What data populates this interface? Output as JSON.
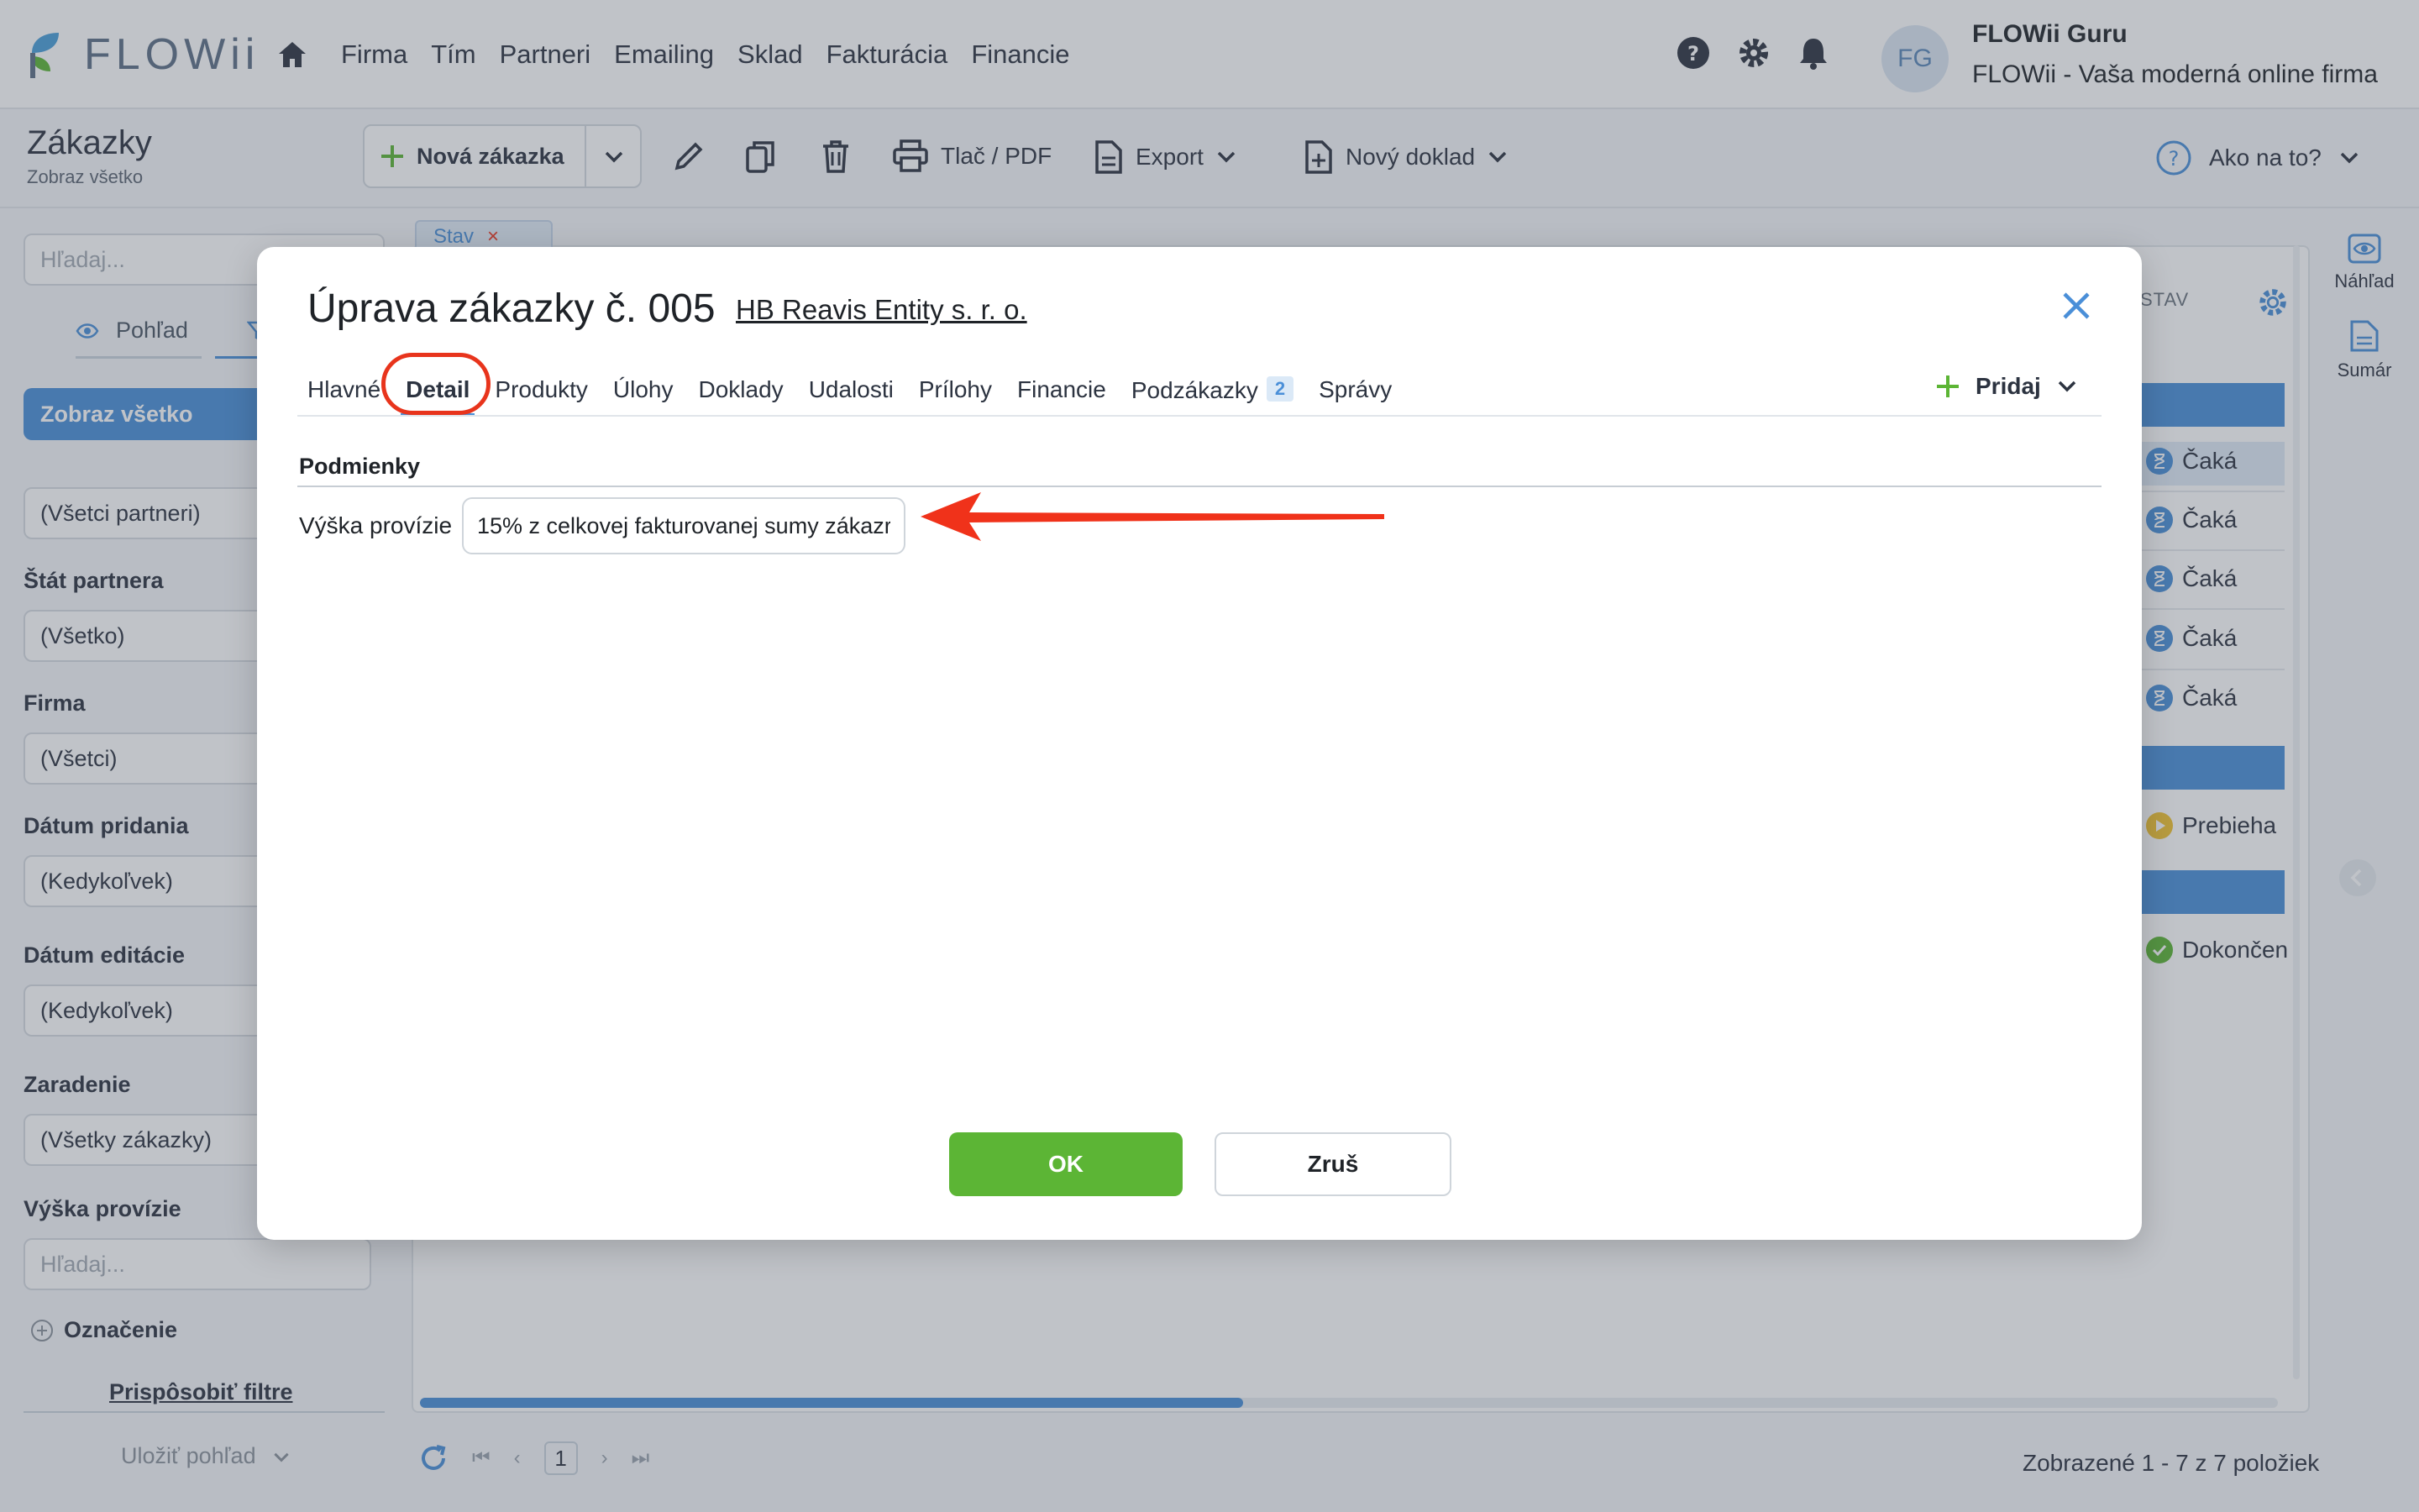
{
  "app": {
    "brand": "FLOWii"
  },
  "nav": {
    "items": [
      "Firma",
      "Tím",
      "Partneri",
      "Emailing",
      "Sklad",
      "Fakturácia",
      "Financie"
    ]
  },
  "user": {
    "initials": "FG",
    "name": "FLOWii Guru",
    "company": "FLOWii - Vaša moderná online firma"
  },
  "page": {
    "title": "Zákazky",
    "subtitle": "Zobraz všetko"
  },
  "toolbar": {
    "new_label": "Nová zákazka",
    "print_label": "Tlač / PDF",
    "export_label": "Export",
    "new_doc_label": "Nový doklad",
    "help_label": "Ako na to?"
  },
  "sidebar": {
    "search_placeholder": "Hľadaj...",
    "view_tab": "Pohľad",
    "show_all": "Zobraz všetko",
    "partners_value": "(Všetci partneri)",
    "state_label": "Štát partnera",
    "state_value": "(Všetko)",
    "company_label": "Firma",
    "company_value": "(Všetci)",
    "date_added_label": "Dátum pridania",
    "date_added_value": "(Kedykoľvek)",
    "date_edited_label": "Dátum editácie",
    "date_edited_value": "(Kedykoľvek)",
    "category_label": "Zaradenie",
    "category_value": "(Všetky zákazky)",
    "commission_label": "Výška provízie",
    "commission_placeholder": "Hľadaj...",
    "tag_label": "Označenie",
    "customize_label": "Prispôsobiť filtre",
    "save_view_label": "Uložiť pohľad"
  },
  "list": {
    "filter_chip": "Stav",
    "column_status": "STAV",
    "statuses": [
      "Čaká",
      "Čaká",
      "Čaká",
      "Čaká",
      "Čaká",
      "Prebieha",
      "Dokončen"
    ],
    "page_number": "1",
    "pager_info": "Zobrazené 1 - 7 z 7 položiek"
  },
  "rail": {
    "preview_label": "Náhľad",
    "summary_label": "Sumár"
  },
  "modal": {
    "title": "Úprava zákazky č. 005",
    "partner_link": "HB Reavis Entity s. r. o.",
    "tabs": [
      {
        "label": "Hlavné"
      },
      {
        "label": "Detail"
      },
      {
        "label": "Produkty"
      },
      {
        "label": "Úlohy"
      },
      {
        "label": "Doklady"
      },
      {
        "label": "Udalosti"
      },
      {
        "label": "Prílohy"
      },
      {
        "label": "Financie"
      },
      {
        "label": "Podzákazky",
        "badge": "2"
      },
      {
        "label": "Správy"
      }
    ],
    "add_label": "Pridaj",
    "section_title": "Podmienky",
    "commission_label": "Výška provízie",
    "commission_value": "15% z celkovej fakturovanej sumy zákazr",
    "ok_label": "OK",
    "cancel_label": "Zruš"
  },
  "colors": {
    "accent": "#4a8fd8",
    "ok": "#5cb535",
    "highlight": "#e8341c"
  }
}
